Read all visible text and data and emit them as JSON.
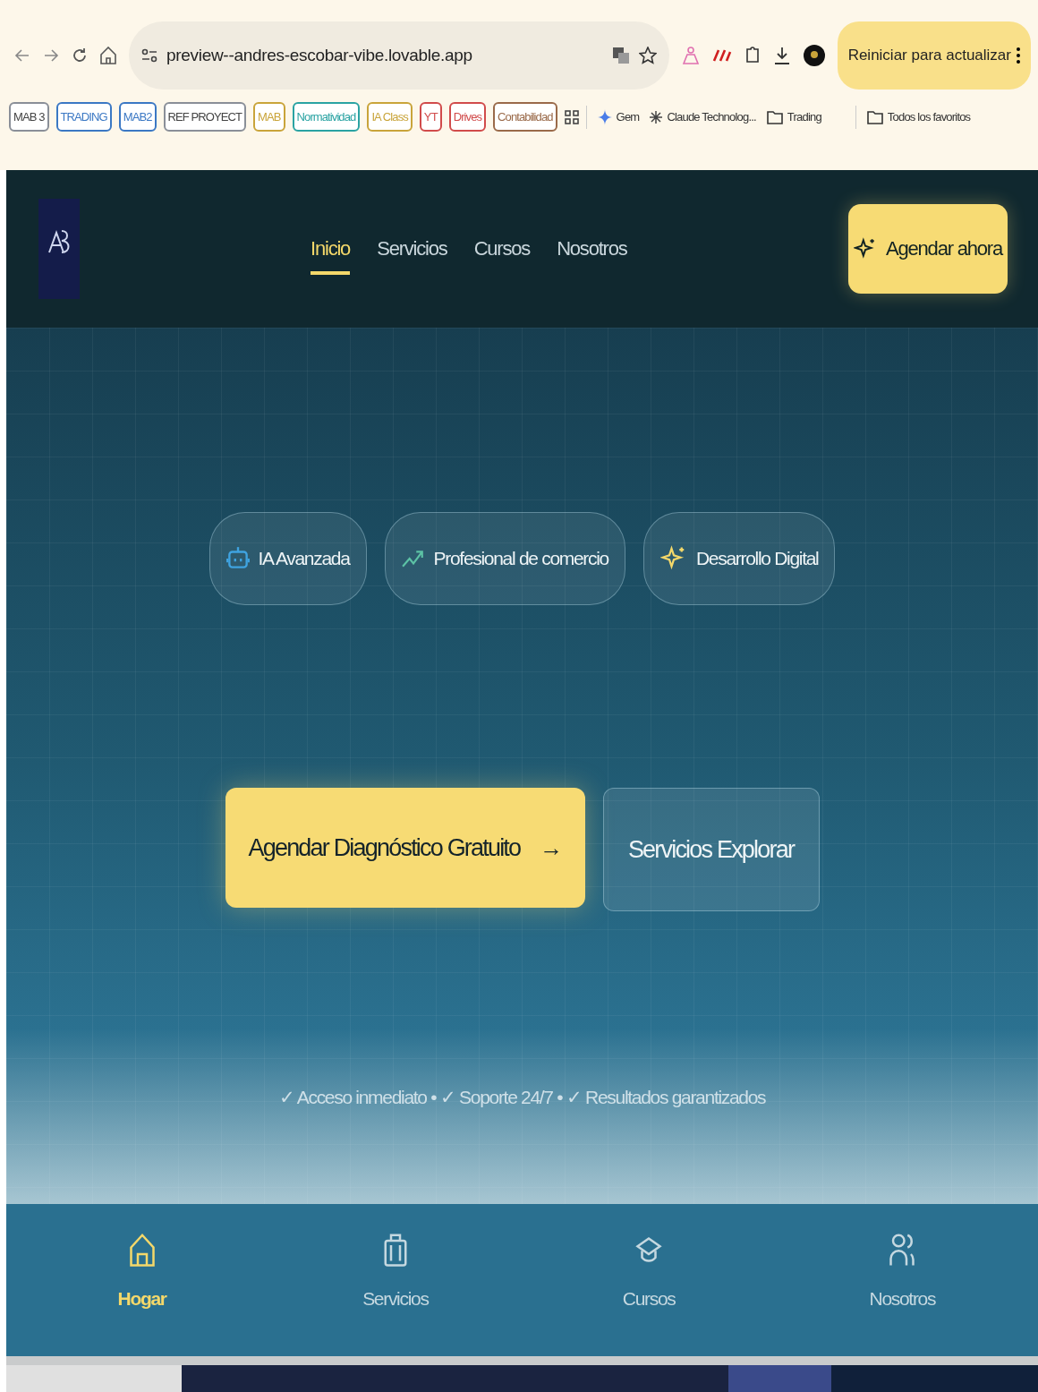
{
  "browser": {
    "url": "preview--andres-escobar-vibe.lovable.app",
    "update_button": "Reiniciar para actualizar",
    "bookmark_chips": [
      {
        "label": "MAB 3",
        "color": "#8a8f98"
      },
      {
        "label": "TRADING",
        "color": "#3b78c4"
      },
      {
        "label": "MAB2",
        "color": "#3b78c4"
      },
      {
        "label": "REF PROYECT",
        "color": "#8a8f98"
      },
      {
        "label": "MAB",
        "color": "#c9a43a"
      },
      {
        "label": "Normatividad",
        "color": "#2aa3a3"
      },
      {
        "label": "IA Class",
        "color": "#c9a43a"
      },
      {
        "label": "YT",
        "color": "#d14b4b"
      },
      {
        "label": "Drives",
        "color": "#d14b4b"
      },
      {
        "label": "Contabilidad",
        "color": "#9a6a4a"
      }
    ],
    "bookmarks": [
      {
        "label": "Gem",
        "kind": "gem"
      },
      {
        "label": "Claude Technolog...",
        "kind": "claude"
      },
      {
        "label": "Trading",
        "kind": "folder"
      }
    ],
    "all_bookmarks": "Todos los favoritos"
  },
  "header": {
    "nav": [
      {
        "label": "Inicio",
        "selected": true
      },
      {
        "label": "Servicios",
        "selected": false
      },
      {
        "label": "Cursos",
        "selected": false
      },
      {
        "label": "Nosotros",
        "selected": false
      }
    ],
    "cta": "Agendar ahora"
  },
  "hero": {
    "chips": [
      {
        "label": "IA Avanzada",
        "kind": "bot"
      },
      {
        "label": "Profesional de comercio",
        "kind": "trend"
      },
      {
        "label": "Desarrollo Digital",
        "kind": "sparkle"
      }
    ],
    "primary_button": "Agendar Diagnóstico Gratuito",
    "primary_arrow": "→",
    "secondary_button": "Servicios Explorar",
    "benefits": "✓ Acceso inmediato • ✓ Soporte 24/7 • ✓ Resultados garantizados"
  },
  "bottom_nav": [
    {
      "label": "Hogar",
      "kind": "home",
      "selected": true
    },
    {
      "label": "Servicios",
      "kind": "briefcase",
      "selected": false
    },
    {
      "label": "Cursos",
      "kind": "cap",
      "selected": false
    },
    {
      "label": "Nosotros",
      "kind": "users",
      "selected": false
    }
  ]
}
